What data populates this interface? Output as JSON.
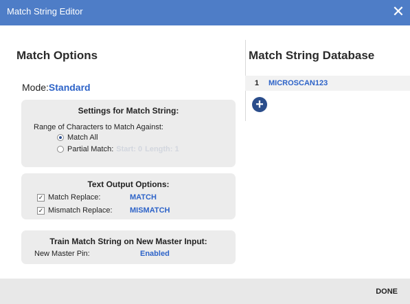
{
  "window": {
    "title": "Match String Editor",
    "close_glyph": "✕"
  },
  "left": {
    "heading": "Match Options",
    "mode_label": "Mode:",
    "mode_value": "Standard",
    "settings_panel": {
      "title": "Settings for Match String:",
      "range_label": "Range of Characters to Match Against:",
      "match_all": {
        "label": "Match All",
        "selected": true
      },
      "partial_match": {
        "label": "Partial Match:",
        "start_label": "Start:",
        "start_value": "0",
        "length_label": "Length:",
        "length_value": "1",
        "selected": false
      }
    },
    "text_output_panel": {
      "title": "Text Output Options:",
      "match_replace": {
        "label": "Match Replace:",
        "value": "MATCH",
        "checked": true
      },
      "mismatch_replace": {
        "label": "Mismatch Replace:",
        "value": "MISMATCH",
        "checked": true
      }
    },
    "train_panel": {
      "title": "Train Match String on New Master Input:",
      "pin_label": "New Master Pin:",
      "pin_value": "Enabled"
    }
  },
  "right": {
    "heading": "Match String Database",
    "rows": [
      {
        "index": "1",
        "value": "MICROSCAN123"
      }
    ],
    "add_icon": "plus-circle-icon"
  },
  "footer": {
    "done_label": "DONE"
  },
  "colors": {
    "titlebar": "#4e7dc7",
    "accent": "#2d63c8",
    "panel": "#ececec",
    "footer": "#e8e8e8"
  }
}
